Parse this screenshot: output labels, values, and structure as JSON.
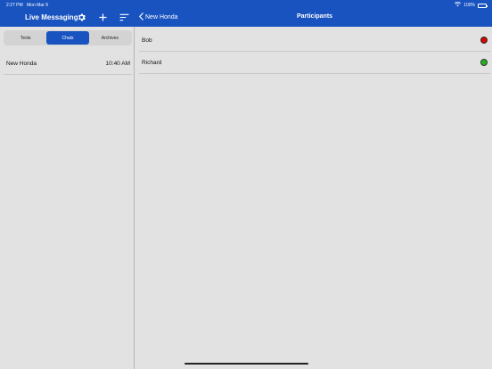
{
  "status": {
    "time": "2:27 PM",
    "date": "Mon Mar 9",
    "battery": "100%"
  },
  "left": {
    "title": "Live Messaging",
    "segments": [
      {
        "label": "Texts",
        "active": false
      },
      {
        "label": "Chats",
        "active": true
      },
      {
        "label": "Archives",
        "active": false
      }
    ],
    "chats": [
      {
        "name": "New Honda",
        "time": "10:40 AM"
      }
    ]
  },
  "right": {
    "back_label": "New Honda",
    "title": "Participants",
    "participants": [
      {
        "name": "Bob",
        "status_color": "#d40000"
      },
      {
        "name": "Richard",
        "status_color": "#1fb31f"
      }
    ]
  },
  "colors": {
    "accent": "#1853c0",
    "background": "#e2e2e2"
  },
  "icons": {
    "settings": "gear-icon",
    "add": "plus-icon",
    "sort": "sort-icon",
    "back": "chevron-left-icon",
    "wifi": "wifi-icon",
    "battery": "battery-icon"
  }
}
